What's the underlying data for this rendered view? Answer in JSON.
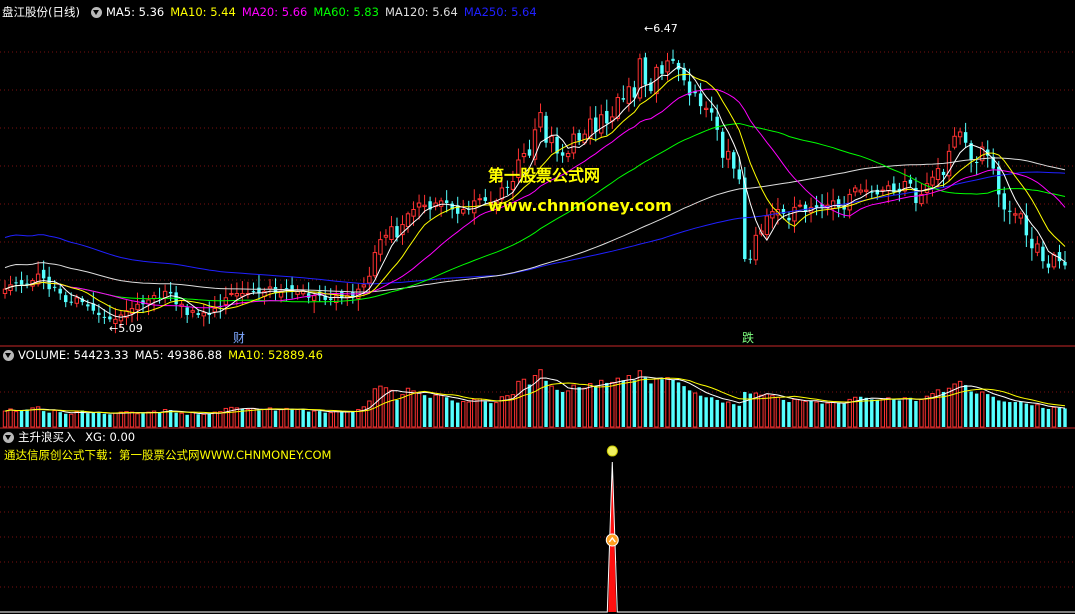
{
  "colors": {
    "up": "#ff3232",
    "down": "#54ffff",
    "ma5": "#ffffff",
    "ma10": "#ffff00",
    "ma20": "#ff00ff",
    "ma60": "#00ff00",
    "ma120": "#dddddd",
    "ma250": "#2020ff",
    "divider": "#a02020",
    "grid": "#7a1010"
  },
  "price_panel": {
    "title": "盘江股份(日线)",
    "legend": [
      {
        "label": "MA5: 5.36",
        "color": "#ffffff"
      },
      {
        "label": "MA10: 5.44",
        "color": "#ffff00"
      },
      {
        "label": "MA20: 5.66",
        "color": "#ff00ff"
      },
      {
        "label": "MA60: 5.83",
        "color": "#00ff00"
      },
      {
        "label": "MA120: 5.64",
        "color": "#dddddd"
      },
      {
        "label": "MA250: 5.64",
        "color": "#2020ff"
      }
    ],
    "high_marker": "6.47",
    "low_marker": "5.09",
    "event_markers": [
      {
        "label": "财",
        "color": "#7fa8ff"
      },
      {
        "label": "跌",
        "color": "#7fff7f"
      }
    ],
    "watermark_cn": "第一股票公式网",
    "watermark_url": "www.chnmoney.com"
  },
  "volume_panel": {
    "legend": [
      {
        "label": "VOLUME: 54423.33",
        "color": "#ffffff"
      },
      {
        "label": "MA5: 49386.88",
        "color": "#ffffff"
      },
      {
        "label": "MA10: 52889.46",
        "color": "#ffff00"
      }
    ]
  },
  "indicator_panel": {
    "title": "主升浪买入",
    "xg_label": "XG: 0.00",
    "note": "通达信原创公式下载：第一股票公式网WWW.CHNMONEY.COM"
  },
  "chart_data": [
    {
      "type": "candlestick",
      "title": "盘江股份(日线)",
      "y_range": [
        5.0,
        6.5
      ],
      "annotated_high": 6.47,
      "annotated_low": 5.09,
      "close": [
        5.25,
        5.27,
        5.28,
        5.27,
        5.27,
        5.29,
        5.32,
        5.3,
        5.25,
        5.26,
        5.23,
        5.19,
        5.19,
        5.21,
        5.19,
        5.17,
        5.15,
        5.13,
        5.12,
        5.11,
        5.11,
        5.13,
        5.15,
        5.16,
        5.18,
        5.18,
        5.2,
        5.22,
        5.21,
        5.24,
        5.23,
        5.18,
        5.18,
        5.13,
        5.15,
        5.13,
        5.14,
        5.13,
        5.16,
        5.17,
        5.21,
        5.23,
        5.23,
        5.23,
        5.23,
        5.24,
        5.23,
        5.24,
        5.26,
        5.23,
        5.24,
        5.25,
        5.24,
        5.24,
        5.24,
        5.21,
        5.22,
        5.22,
        5.2,
        5.2,
        5.22,
        5.21,
        5.22,
        5.21,
        5.25,
        5.27,
        5.31,
        5.42,
        5.48,
        5.5,
        5.54,
        5.49,
        5.55,
        5.6,
        5.62,
        5.65,
        5.64,
        5.62,
        5.65,
        5.66,
        5.65,
        5.62,
        5.6,
        5.62,
        5.62,
        5.66,
        5.67,
        5.66,
        5.65,
        5.66,
        5.72,
        5.72,
        5.75,
        5.85,
        5.88,
        5.87,
        5.99,
        6.07,
        5.93,
        5.96,
        5.88,
        5.87,
        5.88,
        5.97,
        5.94,
        5.97,
        6.04,
        5.98,
        6.06,
        6.02,
        6.05,
        6.14,
        6.13,
        6.19,
        6.14,
        6.32,
        6.2,
        6.17,
        6.28,
        6.25,
        6.31,
        6.31,
        6.27,
        6.22,
        6.15,
        6.16,
        6.1,
        6.09,
        6.07,
        5.99,
        5.86,
        5.89,
        5.81,
        5.76,
        5.39,
        5.39,
        5.5,
        5.52,
        5.59,
        5.61,
        5.62,
        5.6,
        5.57,
        5.63,
        5.64,
        5.61,
        5.63,
        5.63,
        5.63,
        5.64,
        5.66,
        5.63,
        5.62,
        5.69,
        5.72,
        5.71,
        5.71,
        5.7,
        5.69,
        5.71,
        5.73,
        5.7,
        5.7,
        5.75,
        5.74,
        5.65,
        5.69,
        5.74,
        5.77,
        5.81,
        5.78,
        5.89,
        5.96,
        5.98,
        5.93,
        5.85,
        5.84,
        5.91,
        5.87,
        5.81,
        5.69,
        5.62,
        5.61,
        5.6,
        5.6,
        5.5,
        5.44,
        5.46,
        5.38,
        5.35,
        5.41,
        5.38,
        5.36
      ],
      "series": [
        {
          "name": "MA5",
          "last": 5.36
        },
        {
          "name": "MA10",
          "last": 5.44
        },
        {
          "name": "MA20",
          "last": 5.66
        },
        {
          "name": "MA60",
          "last": 5.83
        },
        {
          "name": "MA120",
          "last": 5.64
        },
        {
          "name": "MA250",
          "last": 5.64
        }
      ]
    },
    {
      "type": "bar",
      "name": "VOLUME",
      "last": 54423.33,
      "ma5_last": 49386.88,
      "ma10_last": 52889.46,
      "y_range": [
        0,
        130000
      ],
      "values": [
        30000,
        34000,
        29000,
        31000,
        33000,
        36000,
        38000,
        30000,
        27000,
        31000,
        28000,
        25000,
        24000,
        29000,
        31000,
        26000,
        27000,
        27000,
        25000,
        24000,
        26000,
        28000,
        29000,
        28000,
        25000,
        26000,
        28000,
        30000,
        28000,
        33000,
        32000,
        27000,
        26000,
        23000,
        28000,
        24000,
        24000,
        25000,
        28000,
        29000,
        35000,
        37000,
        36000,
        34000,
        33000,
        35000,
        31000,
        33000,
        36000,
        31000,
        33000,
        35000,
        34000,
        33000,
        34000,
        29000,
        30000,
        30000,
        27000,
        27000,
        30000,
        28000,
        29000,
        29000,
        33000,
        38000,
        49000,
        72000,
        77000,
        74000,
        69000,
        51000,
        61000,
        73000,
        68000,
        65000,
        60000,
        55000,
        60000,
        60000,
        56000,
        50000,
        46000,
        48000,
        47000,
        52000,
        53000,
        48000,
        45000,
        46000,
        57000,
        59000,
        61000,
        86000,
        90000,
        80000,
        97000,
        108000,
        87000,
        77000,
        70000,
        66000,
        68000,
        79000,
        75000,
        73000,
        82000,
        77000,
        88000,
        83000,
        84000,
        92000,
        88000,
        97000,
        88000,
        106000,
        93000,
        82000,
        91000,
        90000,
        93000,
        89000,
        84000,
        77000,
        69000,
        64000,
        59000,
        56000,
        56000,
        51000,
        46000,
        47000,
        43000,
        40000,
        66000,
        63000,
        64000,
        60000,
        62000,
        59000,
        56000,
        51000,
        47000,
        52000,
        51000,
        48000,
        49000,
        47000,
        44000,
        45000,
        46000,
        45000,
        44000,
        52000,
        56000,
        57000,
        55000,
        52000,
        51000,
        53000,
        55000,
        52000,
        50000,
        55000,
        55000,
        49000,
        52000,
        58000,
        63000,
        70000,
        66000,
        73000,
        81000,
        86000,
        79000,
        67000,
        63000,
        66000,
        62000,
        57000,
        50000,
        48000,
        47000,
        47000,
        48000,
        44000,
        41000,
        42000,
        36000,
        34000,
        37000,
        36000,
        35000
      ],
      "up_flags": [
        1,
        1,
        1,
        0,
        0,
        1,
        1,
        0,
        0,
        1,
        0,
        0,
        1,
        1,
        0,
        0,
        0,
        0,
        0,
        0,
        1,
        1,
        1,
        1,
        1,
        0,
        1,
        1,
        0,
        1,
        0,
        0,
        1,
        0,
        1,
        0,
        1,
        0,
        1,
        1,
        1,
        1,
        1,
        0,
        1,
        1,
        0,
        1,
        1,
        0,
        1,
        1,
        0,
        1,
        0,
        0,
        1,
        0,
        0,
        1,
        1,
        0,
        1,
        0,
        1,
        1,
        1,
        1,
        1,
        1,
        1,
        0,
        1,
        1,
        1,
        1,
        0,
        0,
        1,
        1,
        0,
        0,
        0,
        1,
        1,
        1,
        1,
        0,
        0,
        1,
        1,
        1,
        1,
        1,
        1,
        0,
        1,
        1,
        0,
        1,
        0,
        0,
        1,
        1,
        0,
        1,
        1,
        0,
        1,
        0,
        1,
        1,
        0,
        1,
        0,
        1,
        0,
        0,
        1,
        0,
        1,
        0,
        0,
        0,
        0,
        1,
        0,
        0,
        0,
        0,
        0,
        1,
        0,
        0,
        0,
        0,
        1,
        1,
        1,
        1,
        1,
        0,
        0,
        1,
        1,
        1,
        0,
        1,
        0,
        1,
        1,
        0,
        0,
        1,
        1,
        0,
        0,
        0,
        0,
        1,
        1,
        0,
        0,
        1,
        0,
        0,
        1,
        1,
        1,
        1,
        0,
        1,
        1,
        1,
        0,
        0,
        0,
        1,
        0,
        0,
        0,
        0,
        0,
        0,
        0,
        0,
        0,
        1,
        0,
        0,
        1,
        0,
        0
      ]
    },
    {
      "type": "line",
      "name": "主升浪买入",
      "series": [
        {
          "name": "XG",
          "last": 0.0
        }
      ],
      "y_range": [
        0,
        1
      ],
      "signal_bar_index": 110,
      "signal_value": 1
    }
  ]
}
